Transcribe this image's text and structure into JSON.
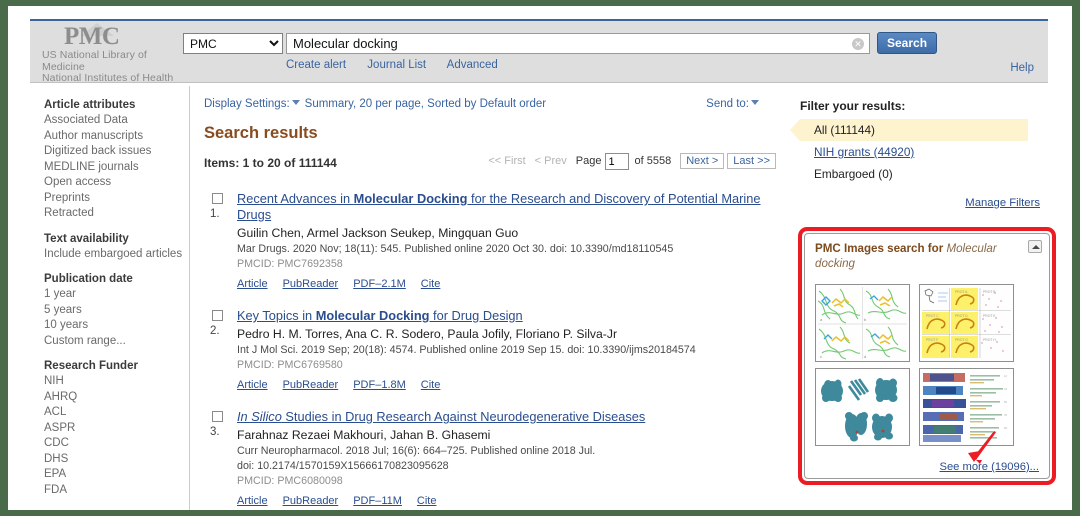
{
  "header": {
    "logo_text": "PMC",
    "org_line1": "US National Library of",
    "org_line2": "Medicine",
    "org_line3": "National Institutes of Health",
    "database_selected": "PMC",
    "database_options": [
      "PMC"
    ],
    "search_value": "Molecular docking",
    "search_placeholder": "",
    "search_button": "Search",
    "clear_icon": "clear-circle-icon",
    "sub_links": [
      "Create alert",
      "Journal List",
      "Advanced"
    ],
    "help_label": "Help"
  },
  "left_sidebar": {
    "groups": [
      {
        "heading": "Article attributes",
        "items": [
          "Associated Data",
          "Author manuscripts",
          "Digitized back issues",
          "MEDLINE journals",
          "Open access",
          "Preprints",
          "Retracted"
        ]
      },
      {
        "heading": "Text availability",
        "items": [
          "Include embargoed articles"
        ]
      },
      {
        "heading": "Publication date",
        "items": [
          "1 year",
          "5 years",
          "10 years",
          "Custom range..."
        ]
      },
      {
        "heading": "Research Funder",
        "items": [
          "NIH",
          "AHRQ",
          "ACL",
          "ASPR",
          "CDC",
          "DHS",
          "EPA",
          "FDA"
        ]
      }
    ]
  },
  "main": {
    "display_settings_label": "Display Settings:",
    "display_settings_value": "Summary, 20 per page, Sorted by Default order",
    "send_to_label": "Send to:",
    "results_title": "Search results",
    "items_summary": "Items: 1 to 20 of 111144",
    "pager": {
      "first": "<< First",
      "prev": "< Prev",
      "page_label": "Page",
      "page_value": "1",
      "of_label": "of 5558",
      "next": "Next >",
      "last": "Last >>"
    },
    "results": [
      {
        "number": "1.",
        "title_parts": [
          {
            "text": "Recent Advances in ",
            "style": "normal"
          },
          {
            "text": "Molecular Docking",
            "style": "bold"
          },
          {
            "text": " for the Research and Discovery of Potential Marine Drugs",
            "style": "normal"
          }
        ],
        "authors": "Guilin Chen, Armel Jackson Seukep, Mingquan Guo",
        "citation": "Mar Drugs. 2020 Nov; 18(11): 545. Published online 2020 Oct 30. doi: 10.3390/md18110545",
        "citation_line2": "",
        "pmcid": "PMCID: PMC7692358",
        "links": [
          "Article",
          "PubReader",
          "PDF–2.1M",
          "Cite"
        ]
      },
      {
        "number": "2.",
        "title_parts": [
          {
            "text": "Key Topics in ",
            "style": "normal"
          },
          {
            "text": "Molecular Docking",
            "style": "bold"
          },
          {
            "text": " for Drug Design",
            "style": "normal"
          }
        ],
        "authors": "Pedro H. M. Torres, Ana C. R. Sodero, Paula Jofily, Floriano P. Silva-Jr",
        "citation": "Int J Mol Sci. 2019 Sep; 20(18): 4574. Published online 2019 Sep 15. doi: 10.3390/ijms20184574",
        "citation_line2": "",
        "pmcid": "PMCID: PMC6769580",
        "links": [
          "Article",
          "PubReader",
          "PDF–1.8M",
          "Cite"
        ]
      },
      {
        "number": "3.",
        "title_parts": [
          {
            "text": "In Silico",
            "style": "italic"
          },
          {
            "text": " Studies in Drug Research Against Neurodegenerative Diseases",
            "style": "normal"
          }
        ],
        "authors": "Farahnaz Rezaei Makhouri, Jahan B. Ghasemi",
        "citation": "Curr Neuropharmacol. 2018 Jul; 16(6): 664–725. Published online 2018 Jul.",
        "citation_line2": "doi: 10.2174/1570159X15666170823095628",
        "pmcid": "PMCID: PMC6080098",
        "links": [
          "Article",
          "PubReader",
          "PDF–11M",
          "Cite"
        ]
      }
    ]
  },
  "right_column": {
    "filter_title": "Filter your results:",
    "filters": [
      {
        "label": "All (111144)",
        "active": true,
        "link": false
      },
      {
        "label": "NIH grants (44920)",
        "active": false,
        "link": true
      },
      {
        "label": "Embargoed (0)",
        "active": false,
        "link": false
      }
    ],
    "manage_filters_label": "Manage Filters",
    "images_panel": {
      "heading_prefix": "PMC Images search for ",
      "heading_query": "Molecular docking",
      "collapse_icon": "collapse-caret-up-icon",
      "thumbnails": [
        {
          "name": "protein-ribbon-green-panels-thumbnail"
        },
        {
          "name": "yellow-highlighted-diagram-grid-thumbnail"
        },
        {
          "name": "teal-protein-structures-thumbnail"
        },
        {
          "name": "sequence-alignment-colored-thumbnail"
        }
      ],
      "see_more_label": "See more (19096)..."
    }
  },
  "annotations": {
    "red_box_target": "pmc-images-search-panel",
    "red_arrow_target": "see-more-link",
    "accent_red": "#ec1c24",
    "highlight_yellow": "#fdf3cf",
    "link_blue": "#2a4d8f",
    "title_brown": "#8a4b1e"
  }
}
